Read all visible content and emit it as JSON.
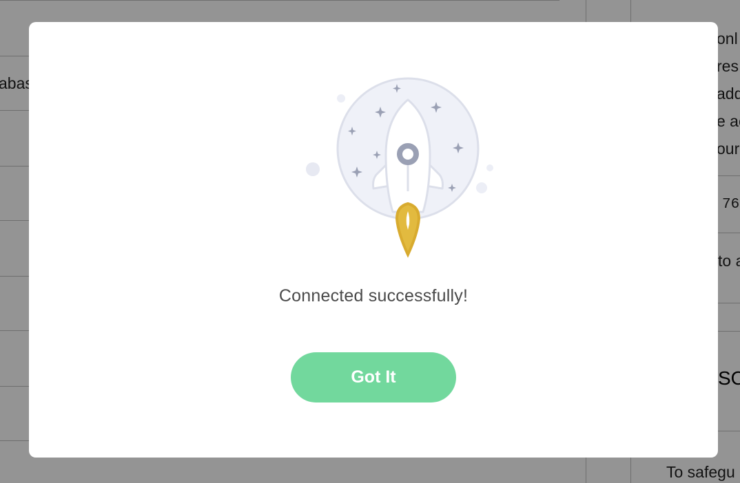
{
  "background": {
    "fragments": {
      "left_row": "abas",
      "right_1": "onl",
      "right_2": "res",
      "right_3": "add",
      "right_4": "e ac",
      "right_5": "our",
      "right_code": "76",
      "right_to": "to a",
      "right_heading": "SO",
      "right_bottom": "To safegu"
    }
  },
  "modal": {
    "illustration": {
      "icon": "rocket-launch-illustration",
      "flame_color": "#d8ab2f",
      "planet_color": "#eff1f8",
      "stars_color": "#9aa0b4"
    },
    "message": "Connected successfully!",
    "button": {
      "label": "Got It",
      "color": "#72d89d"
    }
  }
}
